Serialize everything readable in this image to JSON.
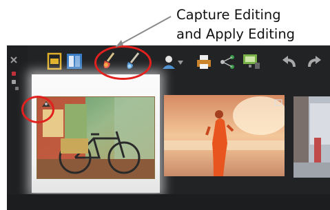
{
  "annotation": {
    "line1": "Capture Editing",
    "line2": "and Apply Editing",
    "highlight_color": "#e2211f"
  },
  "toolbar": {
    "icons": [
      "close-icon",
      "single-view-icon",
      "compare-view-icon",
      "capture-editing-icon",
      "apply-editing-icon",
      "person-icon",
      "dropdown-arrow-icon",
      "print-icon",
      "share-icon",
      "monitor-icon",
      "undo-icon",
      "redo-icon"
    ]
  },
  "thumbnails": [
    {
      "subject": "bicycle-photo",
      "selected": true
    },
    {
      "subject": "sunset-beach-photo",
      "selected": false
    },
    {
      "subject": "street-photo",
      "selected": false
    }
  ]
}
